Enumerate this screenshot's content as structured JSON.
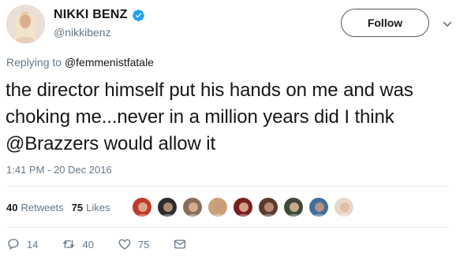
{
  "author": {
    "display_name": "NIKKI BENZ",
    "username": "@nikkibenz",
    "verified": true,
    "avatar_icon": "profile-photo"
  },
  "follow_label": "Follow",
  "reply_context": {
    "prefix": "Replying to",
    "mention": "@femmenistfatale"
  },
  "tweet": {
    "text": "the director himself put his hands on me and was choking me...never in a million years did I think @Brazzers would allow it",
    "timestamp": "1:41 PM - 20 Dec 2016"
  },
  "stats": {
    "retweets_count": "40",
    "retweets_label": "Retweets",
    "likes_count": "75",
    "likes_label": "Likes"
  },
  "likers": [
    {
      "color": "#c0392b"
    },
    {
      "color": "#2c2c2c"
    },
    {
      "color": "#8a6d5a"
    },
    {
      "color": "#c9a27a"
    },
    {
      "color": "#7a1f1f"
    },
    {
      "color": "#5a3b2e"
    },
    {
      "color": "#3d4a3a"
    },
    {
      "color": "#3f6f9a"
    },
    {
      "color": "#e8d8cc"
    }
  ],
  "actions": {
    "reply_count": "14",
    "retweet_count": "40",
    "like_count": "75"
  },
  "colors": {
    "verified": "#1da1f2",
    "secondary_text": "#657786",
    "primary_text": "#14171a"
  }
}
